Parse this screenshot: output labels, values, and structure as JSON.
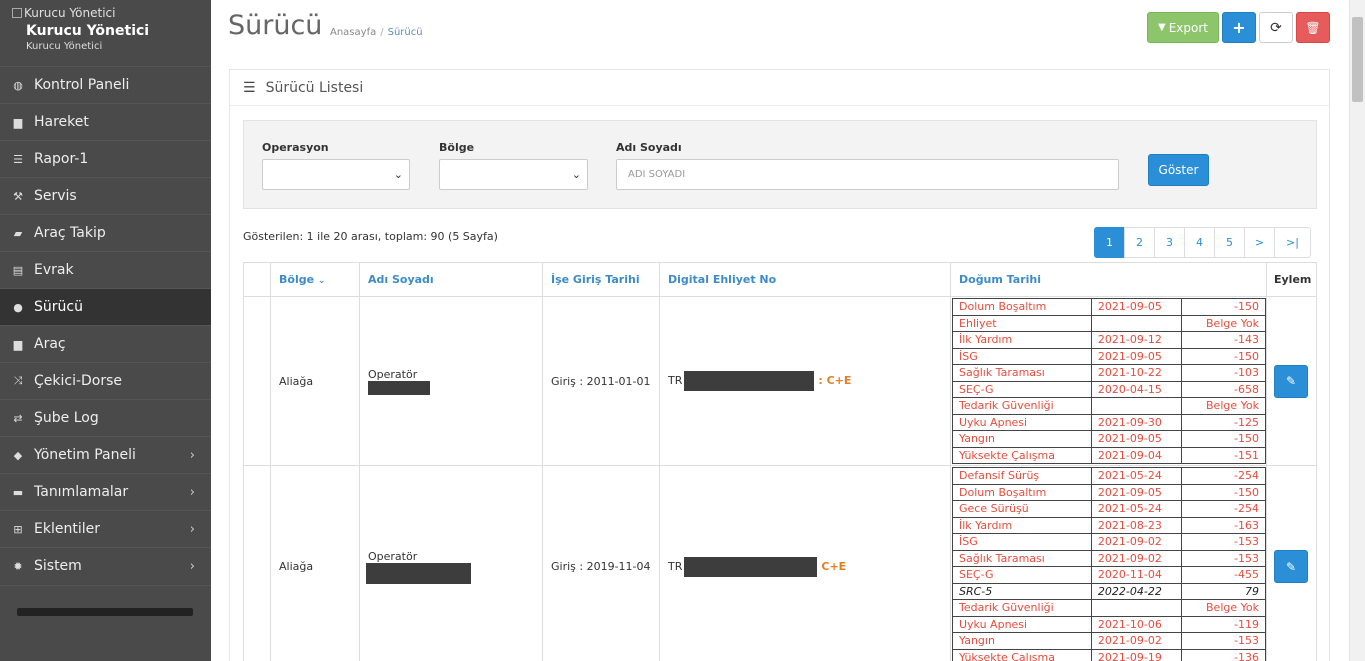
{
  "sidebar": {
    "logo_alt": "Kurucu Yönetici",
    "user_name": "Kurucu Yönetici",
    "user_role": "Kurucu Yönetici",
    "items": [
      {
        "label": "Kontrol Paneli",
        "icon": "dashboard-icon",
        "glyph": "◍"
      },
      {
        "label": "Hareket",
        "icon": "truck-icon",
        "glyph": "▆"
      },
      {
        "label": "Rapor-1",
        "icon": "list-icon",
        "glyph": "☰"
      },
      {
        "label": "Servis",
        "icon": "wrench-icon",
        "glyph": "⚒"
      },
      {
        "label": "Araç Takip",
        "icon": "car-icon",
        "glyph": "▰"
      },
      {
        "label": "Evrak",
        "icon": "newspaper-icon",
        "glyph": "▤"
      },
      {
        "label": "Sürücü",
        "icon": "user-icon",
        "glyph": "●"
      },
      {
        "label": "Araç",
        "icon": "truck-icon",
        "glyph": "▆"
      },
      {
        "label": "Çekici-Dorse",
        "icon": "random-icon",
        "glyph": "⤨"
      },
      {
        "label": "Şube Log",
        "icon": "exchange-icon",
        "glyph": "⇄"
      },
      {
        "label": "Yönetim Paneli",
        "icon": "tags-icon",
        "glyph": "◆"
      },
      {
        "label": "Tanımlamalar",
        "icon": "folder-icon",
        "glyph": "▬"
      },
      {
        "label": "Eklentiler",
        "icon": "sitemap-icon",
        "glyph": "⊞"
      },
      {
        "label": "Sistem",
        "icon": "cog-icon",
        "glyph": "✹"
      }
    ]
  },
  "header": {
    "title": "Sürücü",
    "breadcrumb_home": "Anasayfa",
    "breadcrumb_sep": "/",
    "breadcrumb_current": "Sürücü",
    "export_label": "Export",
    "add_label": "+",
    "refresh_label": "⟳",
    "delete_label": "🗑"
  },
  "panel": {
    "title": "Sürücü Listesi"
  },
  "filters": {
    "operation_label": "Operasyon",
    "region_label": "Bölge",
    "name_label": "Adı Soyadı",
    "name_placeholder": "ADI SOYADI",
    "show_label": "Göster"
  },
  "results": {
    "info": "Gösterilen: 1 ile 20 arası, toplam: 90 (5 Sayfa)",
    "pages": [
      "1",
      "2",
      "3",
      "4",
      "5",
      ">",
      ">|"
    ]
  },
  "table": {
    "headers": {
      "region": "Bölge",
      "name": "Adı Soyadı",
      "start": "İşe Giriş Tarihi",
      "license": "Digital Ehliyet No",
      "birth": "Doğum Tarihi",
      "action": "Eylem"
    },
    "rows": [
      {
        "region": "Aliağa",
        "name": "Operatör",
        "start": "Giriş : 2011-01-01",
        "license_prefix": "TR",
        "license_class": ": C+E",
        "docs": [
          {
            "name": "Dolum Boşaltım",
            "date": "2021-09-05",
            "value": "-150"
          },
          {
            "name": "Ehliyet",
            "date": "",
            "value": "Belge Yok"
          },
          {
            "name": "İlk Yardım",
            "date": "2021-09-12",
            "value": "-143"
          },
          {
            "name": "İSG",
            "date": "2021-09-05",
            "value": "-150"
          },
          {
            "name": "Sağlık Taraması",
            "date": "2021-10-22",
            "value": "-103"
          },
          {
            "name": "SEÇ-G",
            "date": "2020-04-15",
            "value": "-658"
          },
          {
            "name": "Tedarik Güvenliği",
            "date": "",
            "value": "Belge Yok"
          },
          {
            "name": "Uyku Apnesi",
            "date": "2021-09-30",
            "value": "-125"
          },
          {
            "name": "Yangın",
            "date": "2021-09-05",
            "value": "-150"
          },
          {
            "name": "Yüksekte Çalışma",
            "date": "2021-09-04",
            "value": "-151"
          }
        ]
      },
      {
        "region": "Aliağa",
        "name": "Operatör",
        "start": "Giriş : 2019-11-04",
        "license_prefix": "TR",
        "license_class": "C+E",
        "docs": [
          {
            "name": "Defansif Sürüş",
            "date": "2021-05-24",
            "value": "-254"
          },
          {
            "name": "Dolum Boşaltım",
            "date": "2021-09-05",
            "value": "-150"
          },
          {
            "name": "Gece Sürüşü",
            "date": "2021-05-24",
            "value": "-254"
          },
          {
            "name": "İlk Yardım",
            "date": "2021-08-23",
            "value": "-163"
          },
          {
            "name": "İSG",
            "date": "2021-09-02",
            "value": "-153"
          },
          {
            "name": "Sağlık Taraması",
            "date": "2021-09-02",
            "value": "-153"
          },
          {
            "name": "SEÇ-G",
            "date": "2020-11-04",
            "value": "-455"
          },
          {
            "name": "SRC-5",
            "date": "2022-04-22",
            "value": "79",
            "ok": true
          },
          {
            "name": "Tedarik Güvenliği",
            "date": "",
            "value": "Belge Yok"
          },
          {
            "name": "Uyku Apnesi",
            "date": "2021-10-06",
            "value": "-119"
          },
          {
            "name": "Yangın",
            "date": "2021-09-02",
            "value": "-153"
          },
          {
            "name": "Yüksekte Çalışma",
            "date": "2021-09-19",
            "value": "-136"
          }
        ]
      }
    ]
  },
  "colors": {
    "sidebar_bg": "#4a4a4a",
    "accent": "#2a8fd6",
    "export": "#8cc56a",
    "danger": "#e65b5b",
    "expired_text": "#e74c3c",
    "license_class": "#e67e22"
  }
}
